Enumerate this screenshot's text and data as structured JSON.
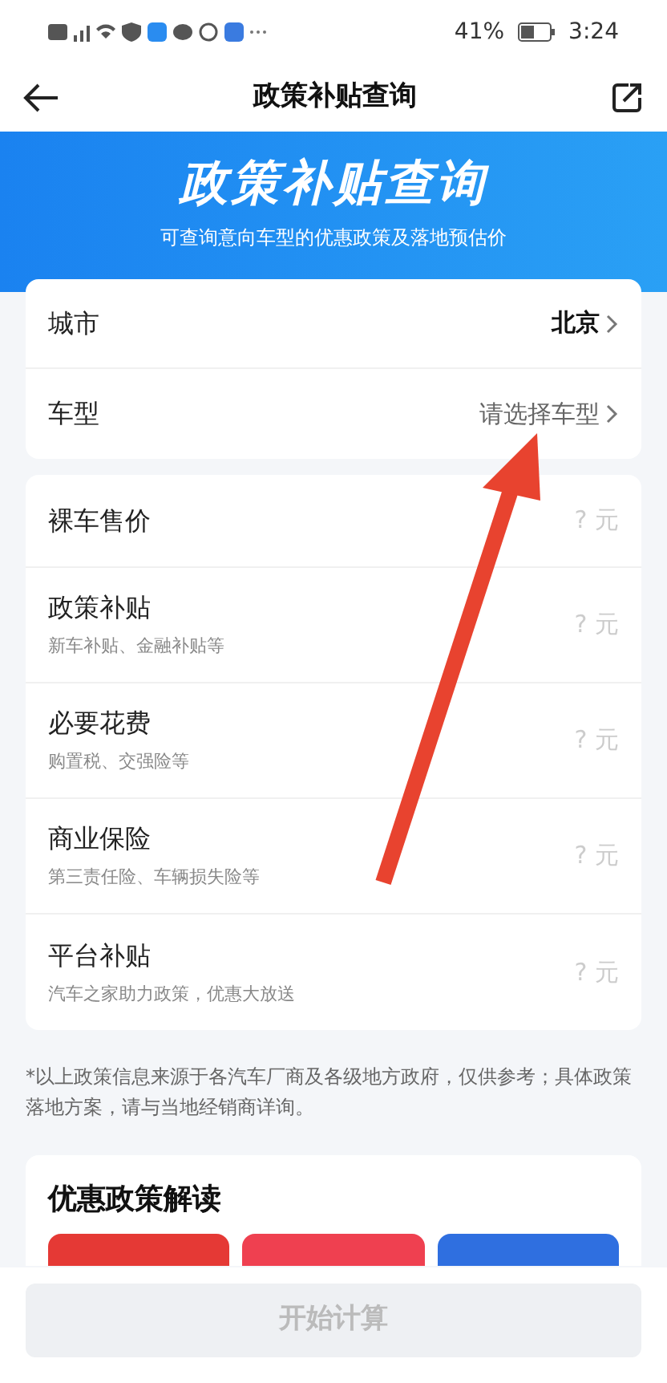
{
  "status_bar": {
    "battery": "41%",
    "time": "3:24"
  },
  "header": {
    "title": "政策补贴查询"
  },
  "banner": {
    "title": "政策补贴查询",
    "subtitle": "可查询意向车型的优惠政策及落地预估价"
  },
  "selectors": [
    {
      "label": "城市",
      "value": "北京",
      "filled": true
    },
    {
      "label": "车型",
      "value": "请选择车型",
      "filled": false
    }
  ],
  "costs": [
    {
      "label": "裸车售价",
      "value": "? 元"
    },
    {
      "label": "政策补贴",
      "hint": "新车补贴、金融补贴等",
      "value": "? 元"
    },
    {
      "label": "必要花费",
      "hint": "购置税、交强险等",
      "value": "? 元"
    },
    {
      "label": "商业保险",
      "hint": "第三责任险、车辆损失险等",
      "value": "? 元"
    },
    {
      "label": "平台补贴",
      "hint": "汽车之家助力政策，优惠大放送",
      "value": "? 元"
    }
  ],
  "disclaimer": "*以上政策信息来源于各汽车厂商及各级地方政府，仅供参考；具体政策落地方案，请与当地经销商详询。",
  "policy_section": {
    "title": "优惠政策解读",
    "tiles": [
      {
        "color": "#e53935"
      },
      {
        "color": "#ef4050"
      },
      {
        "color": "#2f6fe0"
      }
    ]
  },
  "start_button": {
    "label": "开始计算",
    "disabled": true
  }
}
